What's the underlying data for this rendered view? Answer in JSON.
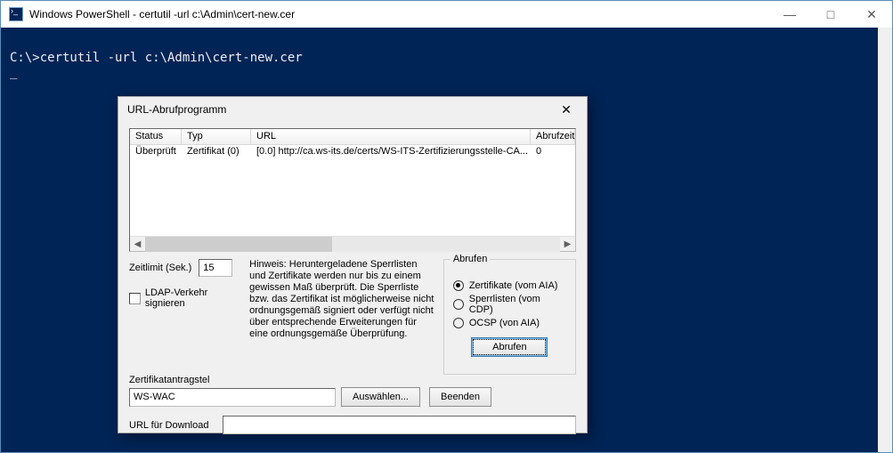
{
  "window": {
    "title": "Windows PowerShell - certutil  -url c:\\Admin\\cert-new.cer"
  },
  "console": {
    "lines": [
      "",
      "C:\\>certutil -url c:\\Admin\\cert-new.cer"
    ]
  },
  "dialog": {
    "title": "URL-Abrufprogramm",
    "columns": {
      "status": "Status",
      "typ": "Typ",
      "url": "URL",
      "abrufzeit": "Abrufzeit"
    },
    "rows": [
      {
        "status": "Überprüft",
        "typ": "Zertifikat (0)",
        "url": "[0.0] http://ca.ws-its.de/certs/WS-ITS-Zertifizierungsstelle-CA...",
        "abrufzeit": "0"
      }
    ],
    "timeout_label": "Zeitlimit (Sek.)",
    "timeout_value": "15",
    "ldap_label": "LDAP-Verkehr signieren",
    "hint": "Hinweis: Heruntergeladene Sperrlisten und Zertifikate werden nur bis zu einem gewissen Maß überprüft. Die Sperrliste bzw. das Zertifikat ist möglicherweise nicht ordnungsgemäß signiert oder verfügt nicht über entsprechende Erweiterungen für eine ordnungsgemäße Überprüfung.",
    "group_title": "Abrufen",
    "radios": [
      {
        "label": "Zertifikate (vom AIA)",
        "selected": true
      },
      {
        "label": "Sperrlisten (vom CDP)",
        "selected": false
      },
      {
        "label": "OCSP (von AIA)",
        "selected": false
      }
    ],
    "abrufen_btn": "Abrufen",
    "subject_label": "Zertifikatantragstel",
    "subject_value": "WS-WAC",
    "select_btn": "Auswählen...",
    "exit_btn": "Beenden",
    "url_download_label": "URL für Download"
  }
}
